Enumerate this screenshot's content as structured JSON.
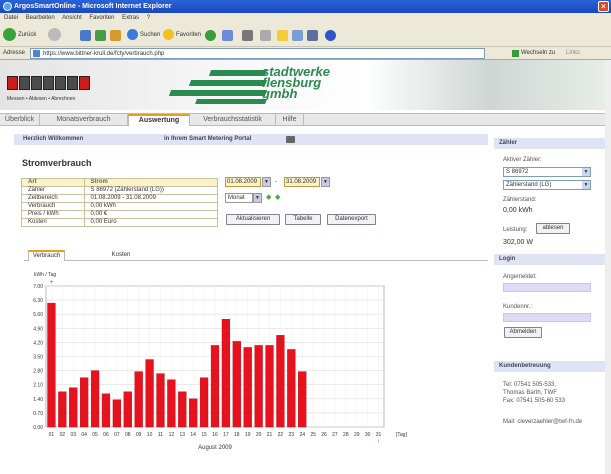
{
  "window": {
    "title": "ArgosSmartOnline - Microsoft Internet Explorer"
  },
  "menu": [
    "Datei",
    "Bearbeiten",
    "Ansicht",
    "Favoriten",
    "Extras",
    "?"
  ],
  "toolbar": {
    "back": "Zurück",
    "search": "Suchen",
    "favorites": "Favoriten"
  },
  "address": {
    "label": "Adresse",
    "url": "https://www.bittner-krull.de/fcty/verbrauch.php",
    "go": "Wechseln zu",
    "links": "Links"
  },
  "header": {
    "logo_sub": "Messen • Ablesen • Abrechnen",
    "brand_line1": "stadtwerke",
    "brand_line2": "flensburg",
    "brand_line3": "gmbh"
  },
  "nav": [
    "Überblick",
    "Monatsverbrauch",
    "Auswertung",
    "Verbrauchsstatistik",
    "Hilfe"
  ],
  "welcome": {
    "left": "Herzlich Willkommen",
    "right": "in Ihrem Smart Metering Portal"
  },
  "main": {
    "title": "Stromverbrauch",
    "table_head": [
      "Art",
      "Strom"
    ],
    "table_rows": [
      [
        "Zähler",
        "S 86972 (Zählerstand (LG))"
      ],
      [
        "Zeitbereich",
        "01.08.2009 - 31.08.2009"
      ],
      [
        "Verbrauch",
        "0,00 kWh"
      ],
      [
        "Preis / kWh",
        "0,00 €"
      ],
      [
        "Kosten",
        "0,00 Euro"
      ]
    ],
    "date_from": "01.08.2009",
    "date_sep": "-",
    "date_to": "31.08.2009",
    "period": "Monat",
    "buttons": {
      "refresh": "Aktualisieren",
      "table": "Tabelle",
      "export": "Datenexport"
    },
    "tabs": [
      "Verbrauch",
      "Kosten"
    ]
  },
  "chart_data": {
    "type": "bar",
    "ylabel": "kWh / Tag",
    "xlabel": "August 2009",
    "x_unit": "[Tag]",
    "ylim": [
      0,
      7
    ],
    "yticks": [
      "0.00",
      "0.70",
      "1.40",
      "2.10",
      "2.80",
      "3.50",
      "4.20",
      "4.90",
      "5.60",
      "6.30",
      "7.00"
    ],
    "categories": [
      "01",
      "02",
      "03",
      "04",
      "05",
      "06",
      "07",
      "08",
      "09",
      "10",
      "11",
      "12",
      "13",
      "14",
      "15",
      "16",
      "17",
      "18",
      "19",
      "20",
      "21",
      "22",
      "23",
      "24",
      "25",
      "26",
      "27",
      "28",
      "29",
      "30",
      "31"
    ],
    "values": [
      6.15,
      1.75,
      1.95,
      2.45,
      2.8,
      1.65,
      1.35,
      1.75,
      2.75,
      3.35,
      2.65,
      2.35,
      1.75,
      1.4,
      2.45,
      4.05,
      5.35,
      4.25,
      3.95,
      4.05,
      4.05,
      4.55,
      3.85,
      2.75,
      null,
      null,
      null,
      null,
      null,
      null,
      null
    ],
    "color": "#e8121f",
    "grid": true
  },
  "sidebar": {
    "zaehler_head": "Zähler",
    "aktiver_label": "Aktiver Zähler:",
    "aktiver_value": "S 86972",
    "type_value": "Zählerstand (LG)",
    "stand_label": "Zählerstand:",
    "stand_value": "0,00 kWh",
    "leistung_label": "Leistung:",
    "ablesen_button": "ablesen",
    "leistung_value": "302,00 W",
    "login_head": "Login",
    "angemeldet_label": "Angemeldet:",
    "kundennr_label": "Kundennr.:",
    "abmelden_button": "Abmelden",
    "kunden_head": "Kundenbetreuung",
    "tel": "Tel: 07541 505-533,",
    "person": "Thomas Barth, TWF",
    "fax": "Fax: 07541 505-60 533",
    "mail": "Mail: cleverzaehler@twf-fn.de"
  }
}
